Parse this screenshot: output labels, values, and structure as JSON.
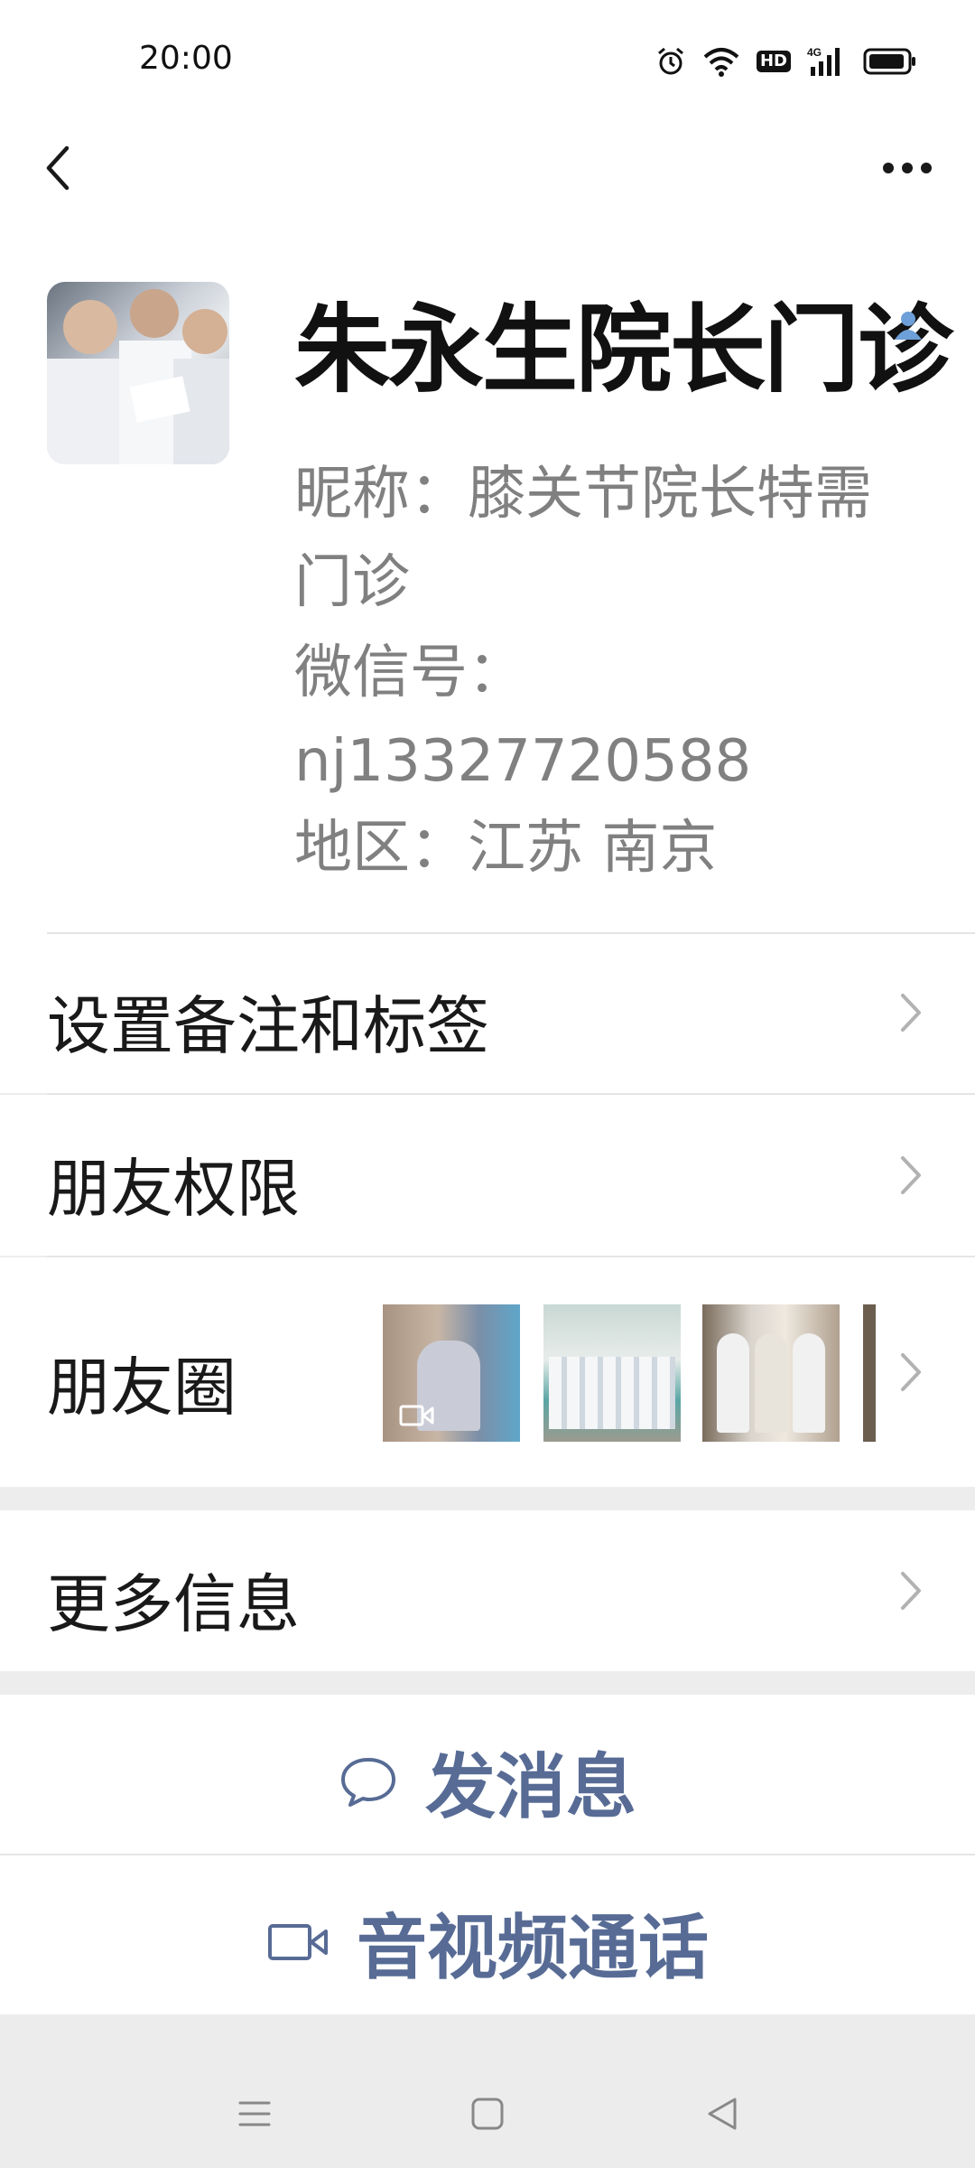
{
  "status_bar": {
    "time": "20:00",
    "network": "4G"
  },
  "contact": {
    "name": "朱永生院长门诊",
    "nickname": "昵称：膝关节院长特需门诊",
    "wechat_id": "微信号：nj13327720588",
    "region": "地区：江苏  南京"
  },
  "rows": {
    "remark": "设置备注和标签",
    "permissions": "朋友权限",
    "moments": "朋友圈",
    "more_info": "更多信息"
  },
  "actions": {
    "message": "发消息",
    "call": "音视频通话"
  },
  "colors": {
    "accent": "#576b95",
    "background": "#ededed"
  }
}
